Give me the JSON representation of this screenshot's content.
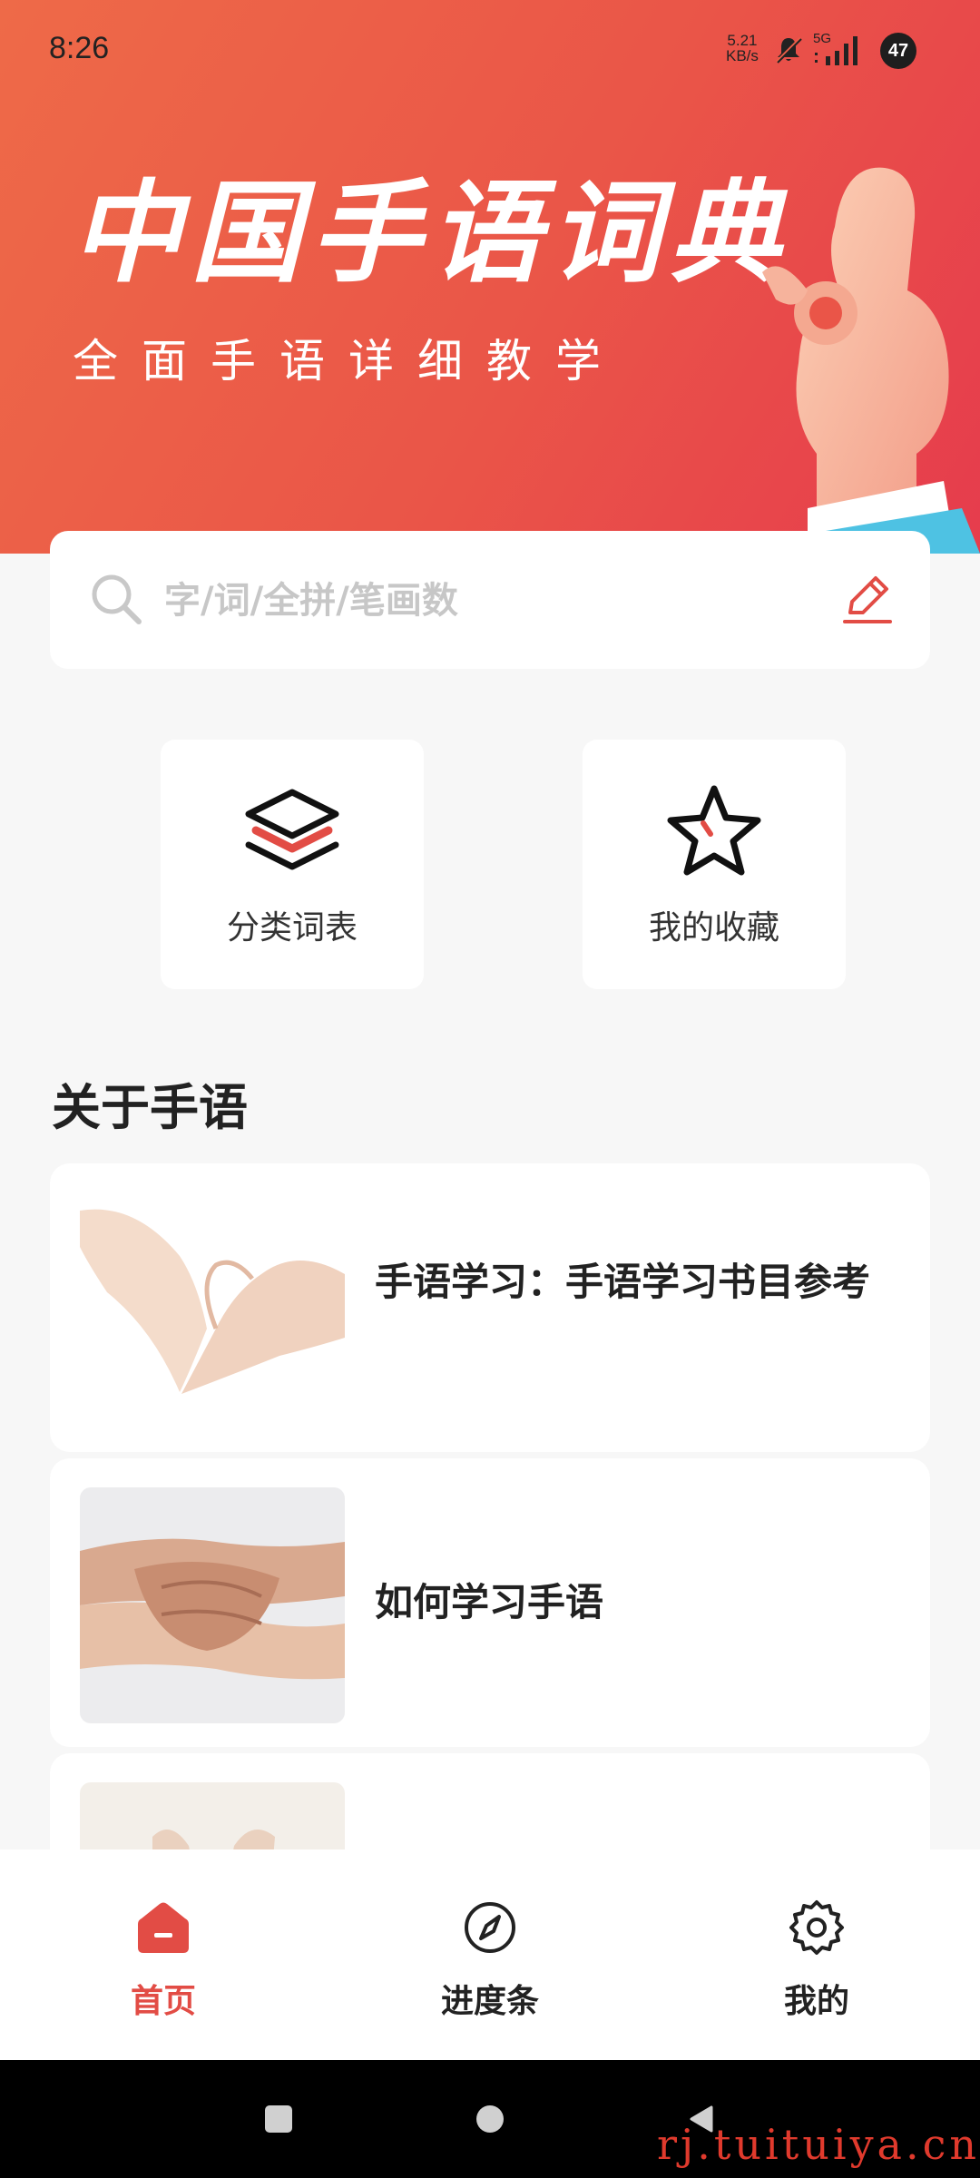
{
  "status_bar": {
    "time": "8:26",
    "net_speed_value": "5.21",
    "net_speed_unit": "KB/s",
    "network": "5G",
    "battery": "47"
  },
  "banner": {
    "title": "中国手语词典",
    "subtitle": "全面手语详细教学"
  },
  "search": {
    "placeholder": "字/词/全拼/笔画数",
    "value": ""
  },
  "quick_tiles": [
    {
      "label": "分类词表",
      "icon": "stack-layers-icon"
    },
    {
      "label": "我的收藏",
      "icon": "star-icon"
    }
  ],
  "section": {
    "title": "关于手语"
  },
  "articles": [
    {
      "title": "手语学习：手语学习书目参考",
      "image": "heart-hands-photo"
    },
    {
      "title": "如何学习手语",
      "image": "joined-hands-photo"
    },
    {
      "title": "",
      "image": "open-palms-photo"
    }
  ],
  "bottom_nav": [
    {
      "label": "首页",
      "icon": "home-icon",
      "active": true
    },
    {
      "label": "进度条",
      "icon": "compass-icon",
      "active": false
    },
    {
      "label": "我的",
      "icon": "gear-icon",
      "active": false
    }
  ],
  "watermark": "rj.tuituiya.cn",
  "colors": {
    "accent": "#e24c45",
    "banner_start": "#ee6a48",
    "banner_end": "#e63c4d",
    "background": "#f7f7f7"
  }
}
